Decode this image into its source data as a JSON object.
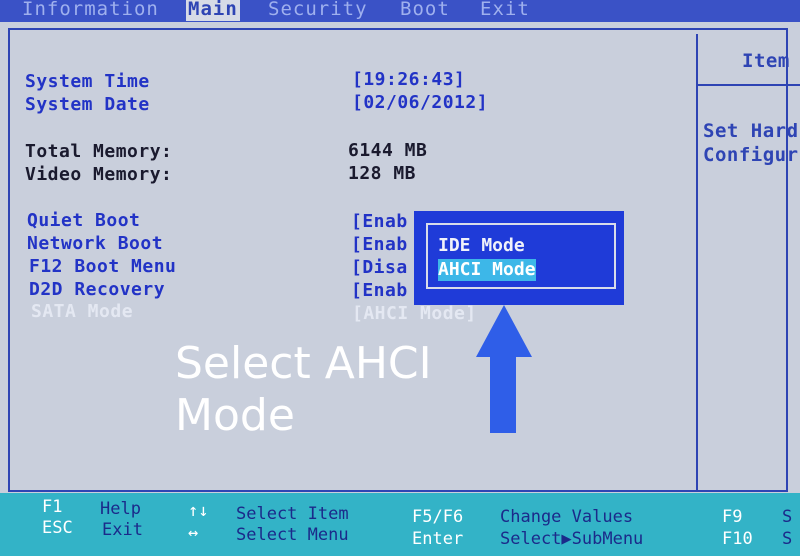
{
  "menu": {
    "tabs": [
      {
        "label": "Information"
      },
      {
        "label": "Main"
      },
      {
        "label": "Security"
      },
      {
        "label": "Boot"
      },
      {
        "label": "Exit"
      }
    ],
    "active_tab": "Main"
  },
  "main": {
    "system_time": {
      "label": "System Time",
      "value": "[19:26:43]"
    },
    "system_date": {
      "label": "System Date",
      "value": "[02/06/2012]"
    },
    "total_memory": {
      "label": "Total Memory:",
      "value": "6144 MB"
    },
    "video_memory": {
      "label": "Video Memory:",
      "value": "128 MB"
    },
    "quiet_boot": {
      "label": "Quiet Boot",
      "value": "[Enab"
    },
    "network_boot": {
      "label": "Network Boot",
      "value": "[Enab"
    },
    "f12_boot_menu": {
      "label": "F12 Boot Menu",
      "value": "[Disa"
    },
    "d2d_recovery": {
      "label": "D2D Recovery",
      "value": "[Enab"
    },
    "sata_mode": {
      "label": "SATA Mode",
      "value": "[AHCI Mode]"
    }
  },
  "popup": {
    "options": [
      "IDE Mode",
      "AHCI Mode"
    ],
    "selected": "AHCI Mode"
  },
  "help_panel": {
    "title": "Item",
    "line1": "Set Hard",
    "line2": "Configur"
  },
  "caption": {
    "line1": "Select AHCI",
    "line2": "Mode"
  },
  "footer": {
    "f1_key": "F1",
    "f1_desc": "Help",
    "esc_key": "ESC",
    "esc_desc": "Exit",
    "updown_key": "↑↓",
    "updown_desc": "Select Item",
    "leftright_key": "↔",
    "leftright_desc": "Select Menu",
    "f5f6_key": "F5/F6",
    "f5f6_desc": "Change Values",
    "enter_key": "Enter",
    "enter_desc": "Select▶SubMenu",
    "f9_key": "F9",
    "f9_desc": "S",
    "f10_key": "F10",
    "f10_desc": "S"
  },
  "colors": {
    "bios_blue": "#2233c6",
    "popup_blue": "#1f3bd8",
    "selection_cyan": "#3db7e8",
    "footer_teal": "#33b3c7",
    "panel_gray": "#c9cfdc",
    "arrow_blue": "#2f5ee8"
  }
}
